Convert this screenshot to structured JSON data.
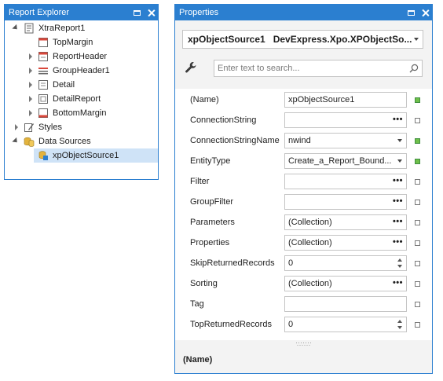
{
  "report_explorer": {
    "title": "Report Explorer",
    "tree": [
      {
        "label": "XtraReport1",
        "icon": "report-icon"
      },
      {
        "label": "TopMargin",
        "icon": "top-margin-band-icon"
      },
      {
        "label": "ReportHeader",
        "icon": "report-header-band-icon"
      },
      {
        "label": "GroupHeader1",
        "icon": "group-header-band-icon"
      },
      {
        "label": "Detail",
        "icon": "detail-band-icon"
      },
      {
        "label": "DetailReport",
        "icon": "detail-report-band-icon"
      },
      {
        "label": "BottomMargin",
        "icon": "bottom-margin-band-icon"
      },
      {
        "label": "Styles",
        "icon": "styles-icon"
      },
      {
        "label": "Data Sources",
        "icon": "data-sources-icon"
      },
      {
        "label": "xpObjectSource1",
        "icon": "xp-object-source-icon"
      }
    ]
  },
  "properties": {
    "title": "Properties",
    "object_selector": {
      "name": "xpObjectSource1",
      "type": "DevExpress.Xpo.XPObjectSo..."
    },
    "search": {
      "placeholder": "Enter text to search..."
    },
    "rows": [
      {
        "name": "(Name)",
        "value": "xpObjectSource1",
        "editor": "text",
        "modified": true
      },
      {
        "name": "ConnectionString",
        "value": "",
        "editor": "ellipsis",
        "modified": false
      },
      {
        "name": "ConnectionStringName",
        "value": "nwind",
        "editor": "dropdown",
        "modified": true
      },
      {
        "name": "EntityType",
        "value": "Create_a_Report_Bound...",
        "editor": "dropdown",
        "modified": true
      },
      {
        "name": "Filter",
        "value": "",
        "editor": "ellipsis",
        "modified": false
      },
      {
        "name": "GroupFilter",
        "value": "",
        "editor": "ellipsis",
        "modified": false
      },
      {
        "name": "Parameters",
        "value": "(Collection)",
        "editor": "ellipsis",
        "modified": false
      },
      {
        "name": "Properties",
        "value": "(Collection)",
        "editor": "ellipsis",
        "modified": false
      },
      {
        "name": "SkipReturnedRecords",
        "value": "0",
        "editor": "spin",
        "modified": false
      },
      {
        "name": "Sorting",
        "value": "(Collection)",
        "editor": "ellipsis",
        "modified": false
      },
      {
        "name": "Tag",
        "value": "",
        "editor": "text",
        "modified": false
      },
      {
        "name": "TopReturnedRecords",
        "value": "0",
        "editor": "spin",
        "modified": false
      }
    ],
    "ellipsis_glyph": "•••",
    "description_title": "(Name)"
  },
  "colors": {
    "accent": "#2b7fd0",
    "selection": "#cfe3f7",
    "modified_marker": "#6fbf4a"
  }
}
